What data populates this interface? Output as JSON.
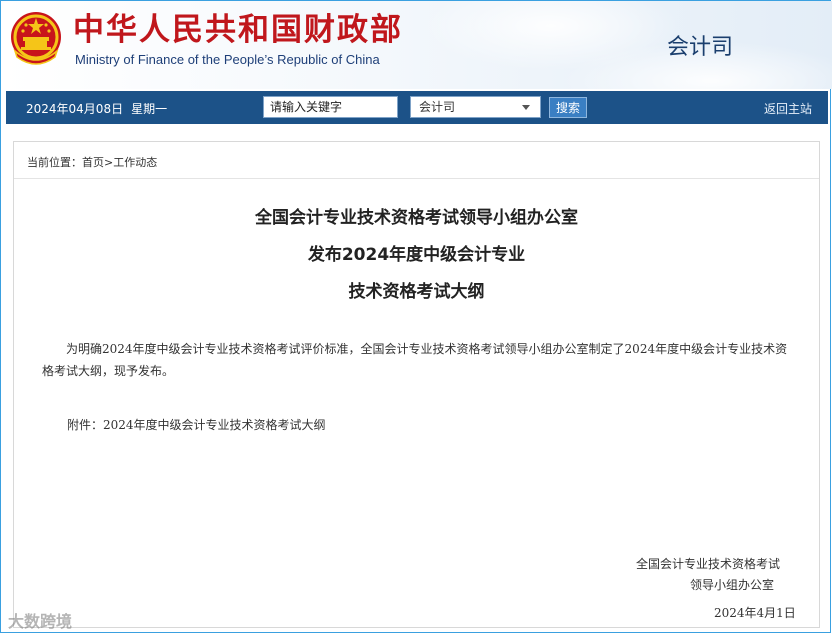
{
  "header": {
    "ministry_cn": "中华人民共和国财政部",
    "ministry_en": "Ministry of Finance of the People’s Republic of China",
    "department": "会计司"
  },
  "navbar": {
    "date": "2024年04月08日",
    "weekday": "星期一",
    "search_placeholder": "请输入关键字",
    "select_value": "会计司",
    "search_button": "搜索",
    "back_link": "返回主站"
  },
  "breadcrumb": "当前位置：首页>工作动态",
  "article": {
    "title_lines": [
      "全国会计专业技术资格考试领导小组办公室",
      "发布2024年度中级会计专业",
      "技术资格考试大纲"
    ],
    "body": "为明确2024年度中级会计专业技术资格考试评价标准，全国会计专业技术资格考试领导小组办公室制定了2024年度中级会计专业技术资格考试大纲，现予发布。",
    "attachment": "附件：2024年度中级会计专业技术资格考试大纲",
    "signature_line1": "全国会计专业技术资格考试",
    "signature_line2": "领导小组办公室",
    "signature_date": "2024年4月1日"
  },
  "watermark": "大数跨境",
  "colors": {
    "navbar_bg": "#1c5288",
    "ministry_red": "#c0171c",
    "button_blue": "#3a7fc3",
    "frame_border": "#3aa0e0"
  },
  "icons": {
    "emblem": "national-emblem-icon",
    "dropdown": "chevron-down-icon"
  }
}
